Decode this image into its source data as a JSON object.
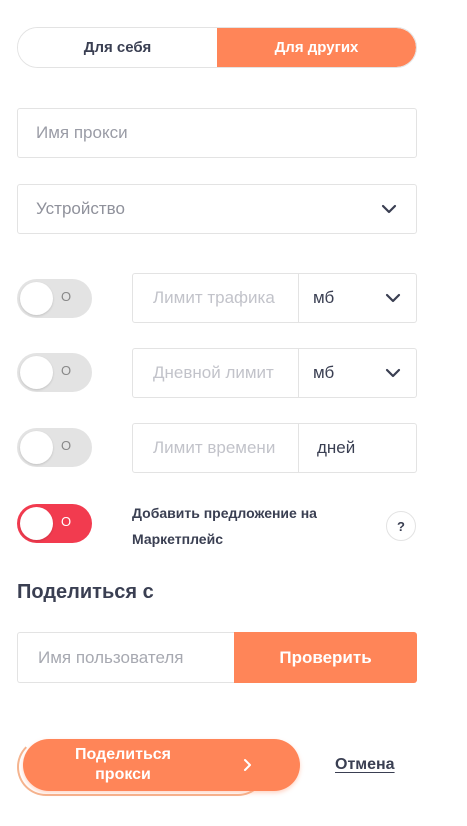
{
  "colors": {
    "accent": "#ff8558",
    "danger": "#f23b4f",
    "text": "#3a3f52",
    "border": "#e3e3e3"
  },
  "segment": {
    "left_label": "Для себя",
    "right_label": "Для других",
    "selected": "Для других"
  },
  "proxy_name": {
    "placeholder": "Имя прокси",
    "value": ""
  },
  "device": {
    "label": "Устройство",
    "icon": "chevron-down-icon"
  },
  "limits": [
    {
      "toggle_label": "O",
      "enabled": false,
      "placeholder": "Лимит трафика",
      "unit": "мб",
      "unit_dropdown": true
    },
    {
      "toggle_label": "O",
      "enabled": false,
      "placeholder": "Дневной лимит",
      "unit": "мб",
      "unit_dropdown": true
    },
    {
      "toggle_label": "O",
      "enabled": false,
      "placeholder": "Лимит времени",
      "unit": "дней",
      "unit_dropdown": false
    }
  ],
  "marketplace": {
    "toggle_label": "O",
    "enabled": true,
    "text": "Добавить предложение на Маркетплейс",
    "help": "?"
  },
  "share": {
    "title": "Поделиться с",
    "username_placeholder": "Имя пользователя",
    "check_label": "Проверить",
    "submit_label": "Поделиться\nпрокси",
    "cancel_label": "Отмена"
  }
}
